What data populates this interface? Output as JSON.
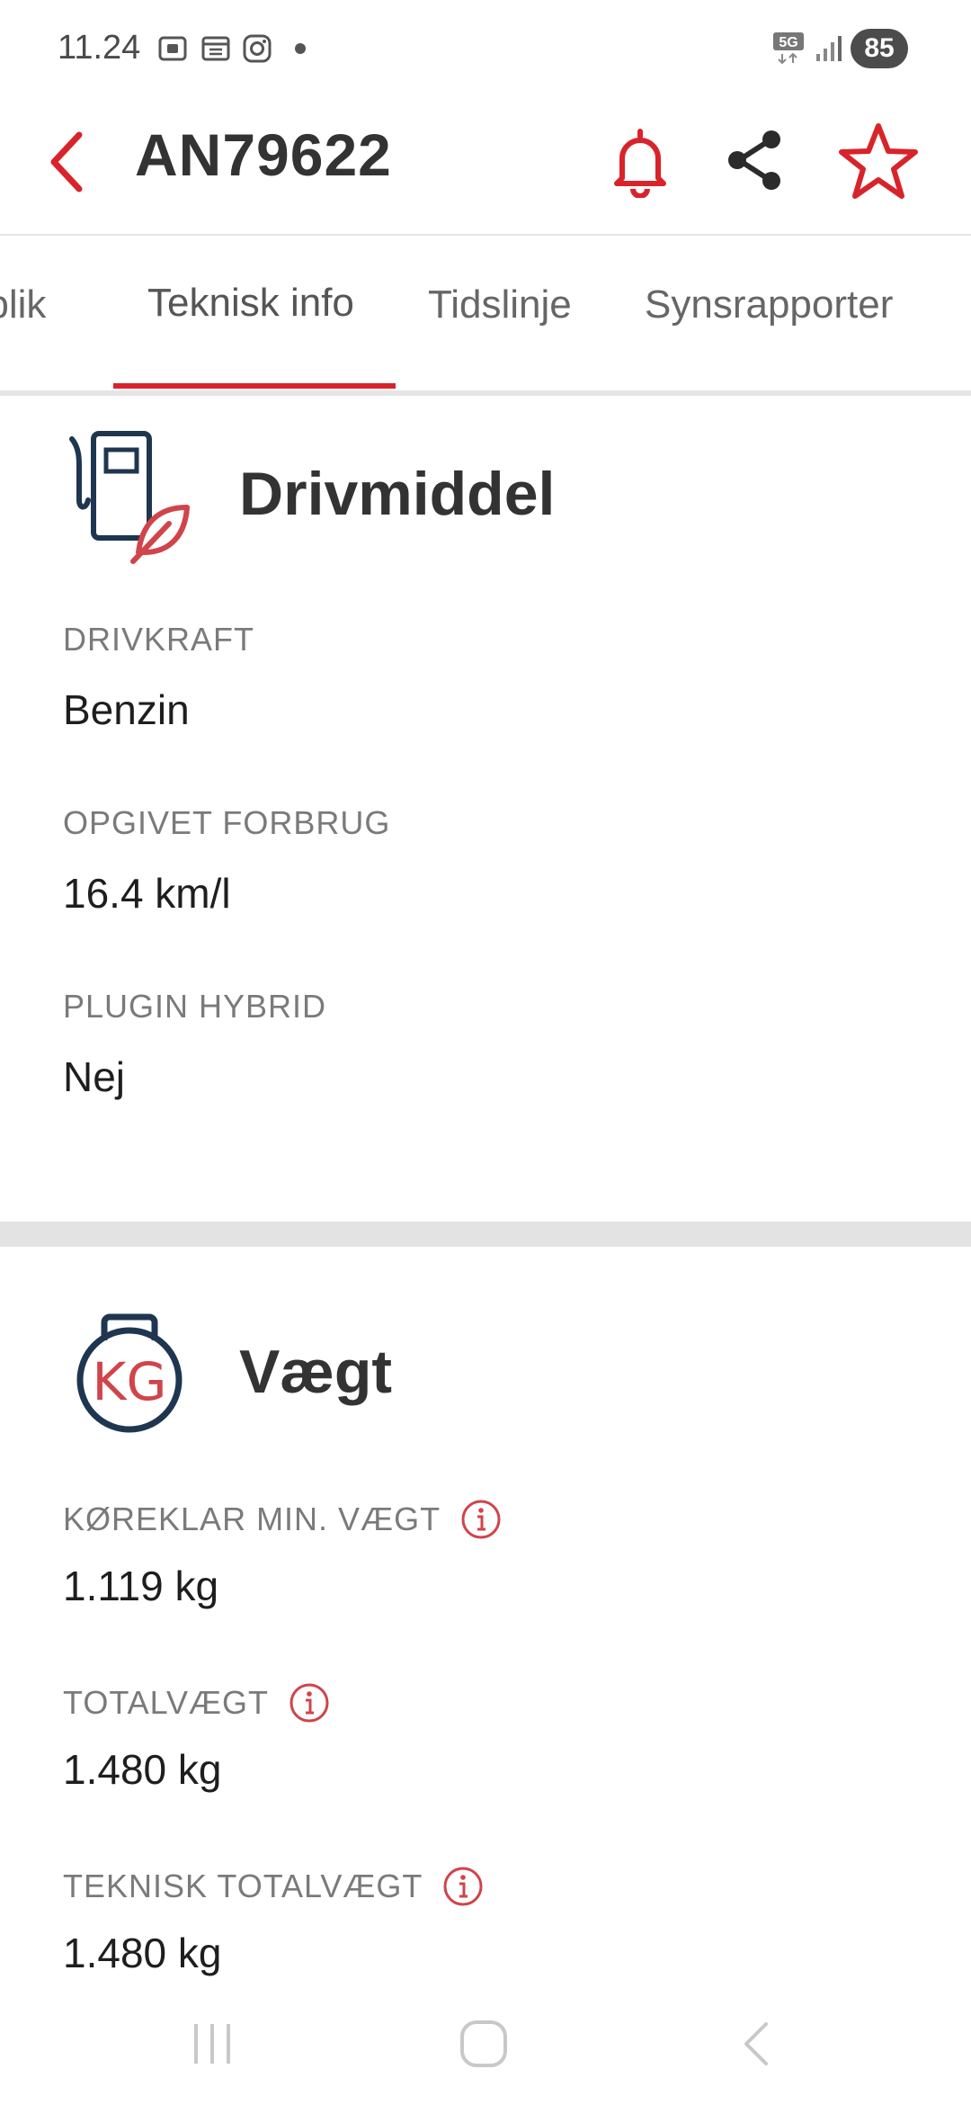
{
  "status": {
    "time": "11.24",
    "network": "5G",
    "battery": "85"
  },
  "appbar": {
    "title": "AN79622"
  },
  "tabs": [
    {
      "label": "Overblik",
      "active": false
    },
    {
      "label": "Teknisk info",
      "active": true
    },
    {
      "label": "Tidslinje",
      "active": false
    },
    {
      "label": "Synsrapporter",
      "active": false
    }
  ],
  "fuel": {
    "title": "Drivmiddel",
    "fields": [
      {
        "label": "DRIVKRAFT",
        "value": "Benzin"
      },
      {
        "label": "OPGIVET FORBRUG",
        "value": "16.4 km/l"
      },
      {
        "label": "PLUGIN HYBRID",
        "value": "Nej"
      }
    ]
  },
  "weight": {
    "title": "Vægt",
    "icon_text": "KG",
    "fields": [
      {
        "label": "KØREKLAR MIN. VÆGT",
        "value": "1.119 kg"
      },
      {
        "label": "TOTALVÆGT",
        "value": "1.480 kg"
      },
      {
        "label": "TEKNISK TOTALVÆGT",
        "value": "1.480 kg"
      }
    ]
  },
  "colors": {
    "accent": "#d9232a",
    "icon_red": "#d0444a",
    "navy": "#1f3650"
  }
}
